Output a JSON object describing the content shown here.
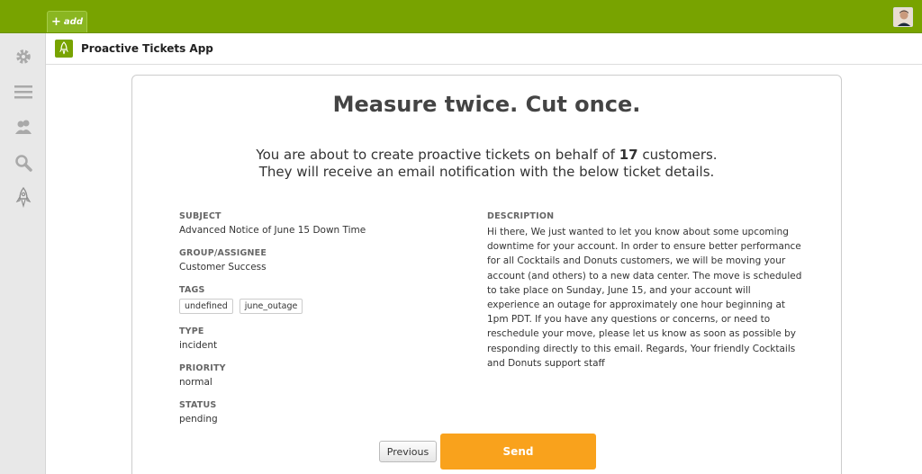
{
  "topbar": {
    "add_label": "add",
    "add_icon": "plus-icon",
    "avatar_icon": "user-avatar"
  },
  "sidebar": {
    "items": [
      {
        "icon": "gear-icon"
      },
      {
        "icon": "list-icon"
      },
      {
        "icon": "users-icon"
      },
      {
        "icon": "search-icon"
      },
      {
        "icon": "rocket-icon"
      }
    ]
  },
  "app": {
    "title": "Proactive Tickets App",
    "logo_icon": "rocket-icon"
  },
  "confirm": {
    "heading": "Measure twice. Cut once.",
    "intro_line1_prefix": "You are about to create proactive tickets on behalf of ",
    "customer_count": "17",
    "intro_line1_suffix": " customers.",
    "intro_line2": "They will receive an email notification with the below ticket details."
  },
  "ticket": {
    "subject_label": "SUBJECT",
    "subject": "Advanced Notice of June 15 Down Time",
    "group_label": "GROUP/ASSIGNEE",
    "group": "Customer Success",
    "tags_label": "TAGS",
    "tags": [
      "undefined",
      "june_outage"
    ],
    "type_label": "TYPE",
    "type": "incident",
    "priority_label": "PRIORITY",
    "priority": "normal",
    "status_label": "STATUS",
    "status": "pending",
    "description_label": "DESCRIPTION",
    "description": "Hi there, We just wanted to let you know about some upcoming downtime for your account. In order to ensure better performance for all Cocktails and Donuts customers, we will be moving your account (and others) to a new data center. The move is scheduled to take place on Sunday, June 15, and your account will experience an outage for approximately one hour beginning at 1pm PDT. If you have any questions or concerns, or need to reschedule your move, please let us know as soon as possible by responding directly to this email. Regards, Your friendly Cocktails and Donuts support staff"
  },
  "actions": {
    "previous_label": "Previous",
    "send_label": "Send"
  },
  "colors": {
    "topbar": "#78a300",
    "send": "#f9a21c"
  }
}
